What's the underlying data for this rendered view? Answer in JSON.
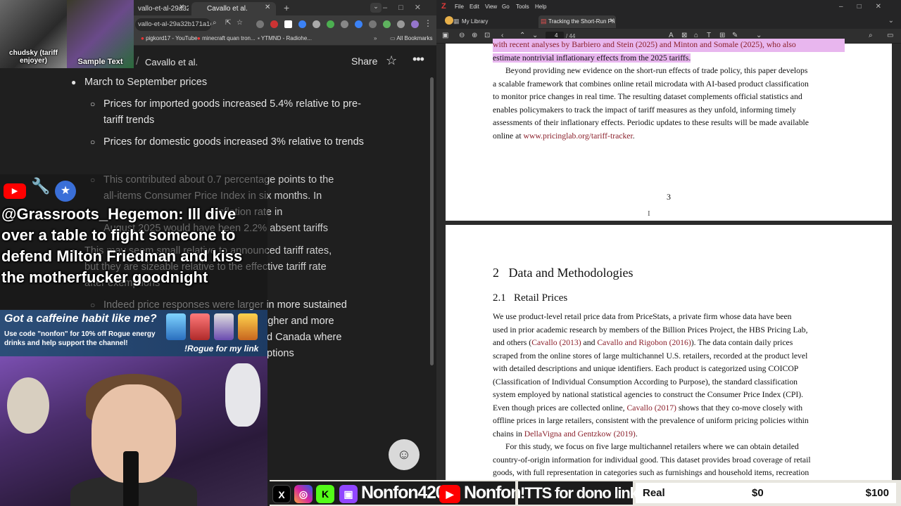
{
  "chrome": {
    "tabs": [
      {
        "label": "vallo-et-al-29a32b171a168..."
      },
      {
        "label": "Cavallo et al."
      }
    ],
    "url": "vallo-et-al-29a32b171a168...",
    "bookmarks": [
      {
        "label": "pigkord17 - YouTube"
      },
      {
        "label": "minecraft quan tron..."
      },
      {
        "label": "YTMND - Radiohe..."
      },
      {
        "label": "All Bookmarks"
      }
    ],
    "header": {
      "title": "Cavallo et al.",
      "share_label": "Share"
    }
  },
  "notes": {
    "bullet_main": "March to September prices",
    "sub_bullets": [
      "Prices for imported goods increased 5.4% relative to pre-tariff trends",
      "Prices for domestic goods increased 3% relative to trends"
    ],
    "obscured_lines": [
      "This contributed about 0.7 percentage points to the",
      "all-items Consumer Price Index in six months. In",
      "inflation rate in",
      "August 2025 would have been 2.2% absent tariffs",
      "This may seem small relative to announced tariff rates,",
      "but they are sizeable relative to the effective tariff rate",
      "after exemptions",
      "Indeed price responses were larger in more sustained",
      "higher and more",
      "d Canada where",
      "ptions"
    ]
  },
  "stream": {
    "cam_caption_left": "chudsky (tariff enjoyer)",
    "cam_caption_right": "Sample Text",
    "chat_message": "@Grassroots_Hegemon: Ill dive over a table to fight someone to defend Milton Friedman and kiss the motherfucker goodnight",
    "ad_title": "Got a caffeine habit like me?",
    "ad_body": "Use code \"nonfon\" for 10% off Rogue energy drinks and help support the channel!",
    "ad_cta": "!Rogue for my link",
    "handles": [
      "Nonfon420",
      "Nonfon"
    ],
    "tts_label": "!TTS for dono link",
    "goal": {
      "label": "Real",
      "current": "$0",
      "target": "$100",
      "progress": 0
    }
  },
  "zotero": {
    "menu": [
      "File",
      "Edit",
      "View",
      "Go",
      "Tools",
      "Help"
    ],
    "library_tab": "My Library",
    "doc_tab": "Tracking the Short-Run Pri",
    "page_current": "4",
    "page_total": "/ 44",
    "page3": {
      "top_line_a": "with recent analyses by Barbiero and Stein (2025) and Minton and Somale (2025), who also",
      "top_line_b": "estimate nontrivial inflationary effects from the 2025 tariffs.",
      "para_lines": [
        "Beyond providing new evidence on the short-run effects of trade policy, this paper develops",
        "a scalable framework that combines online retail microdata with AI-based product classification",
        "to monitor price changes in real time. The resulting dataset complements official statistics and",
        "enables policymakers to track the impact of tariff measures as they unfold, informing timely",
        "assessments of their inflationary effects. Periodic updates to these results will be made available"
      ],
      "para_last_prefix": "online at ",
      "para_link": "www.pricinglab.org/tariff-tracker",
      "para_last_suffix": ".",
      "page_number": "3"
    },
    "page4": {
      "section": "2   Data and Methodologies",
      "subsection": "2.1   Retail Prices",
      "p1_l1": "We use product-level retail price data from PriceStats, a private firm whose data have been",
      "p1_l2": "used in prior academic research by members of the Billion Prices Project, the HBS Pricing Lab,",
      "p1_l3_a": "and others (",
      "p1_l3_link1": "Cavallo (2013)",
      "p1_l3_b": " and ",
      "p1_l3_link2": "Cavallo and Rigobon (2016)",
      "p1_l3_c": "). The data contain daily prices",
      "p1_l4": "scraped from the online stores of large multichannel U.S. retailers, recorded at the product level",
      "p1_l5": "with detailed descriptions and unique identifiers. Each product is categorized using COICOP",
      "p1_l6": "(Classification of Individual Consumption According to Purpose), the standard classification",
      "p1_l7": "system employed by national statistical agencies to construct the Consumer Price Index (CPI).",
      "p1_l8_a": "Even though prices are collected online, ",
      "p1_l8_link": "Cavallo (2017)",
      "p1_l8_b": " shows that they co-move closely with",
      "p1_l9": "offline prices in large retailers, consistent with the prevalence of uniform pricing policies within",
      "p1_l10_a": "chains in ",
      "p1_l10_link": "DellaVigna and Gentzkow (2019)",
      "p1_l10_b": ".",
      "p2_l1": "For this study, we focus on five large multichannel retailers where we can obtain detailed",
      "p2_l2": "country-of-origin information for individual good. This dataset provides broad coverage of retail",
      "p2_l3": "goods, with full representation in categories such as furnishings and household items, recreation"
    }
  }
}
